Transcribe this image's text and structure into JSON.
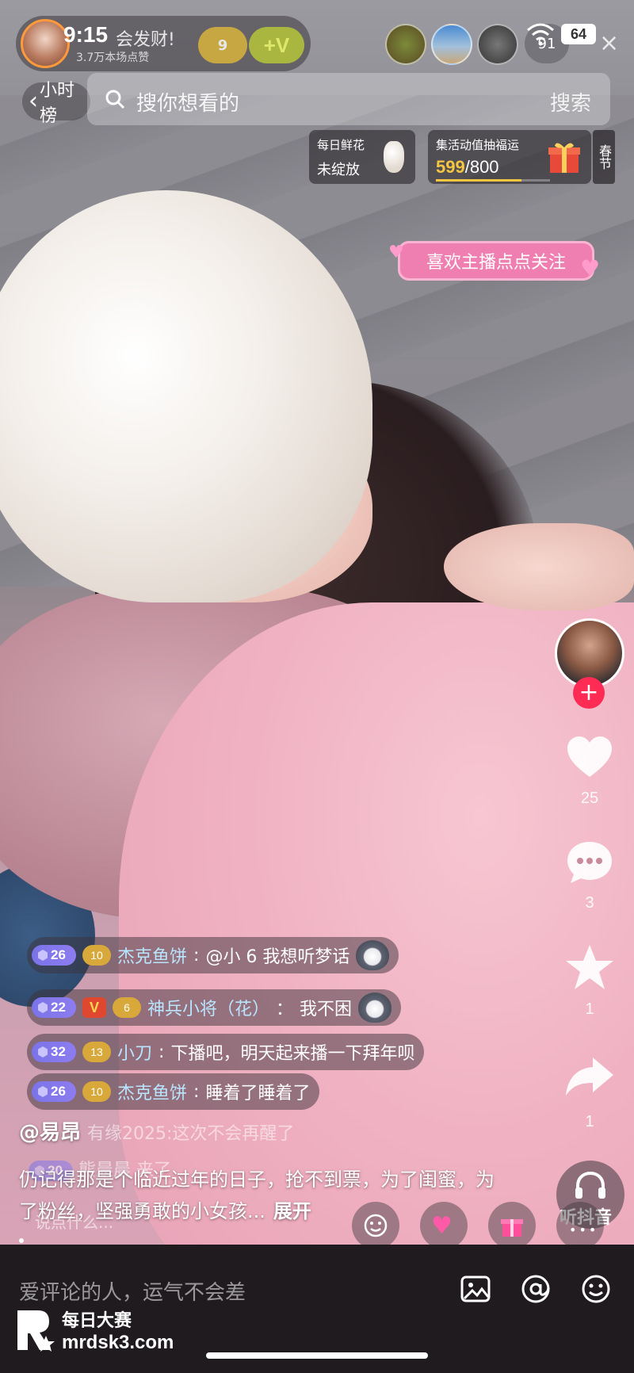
{
  "status_bar": {
    "time": "9:15",
    "battery": "64"
  },
  "anchor": {
    "name_suffix": "会发财!",
    "likes": "3.7万本场点赞",
    "badge_level": "9",
    "badge_v": "+V"
  },
  "viewers": {
    "count": "91"
  },
  "nav": {
    "back_label": "小时榜"
  },
  "search": {
    "placeholder": "搜你想看的",
    "button": "搜索"
  },
  "flower_card": {
    "title": "每日鲜花",
    "status": "未绽放"
  },
  "event_card": {
    "title": "集活动值抽福运",
    "current": "599",
    "total": "/800",
    "progress": 0.749,
    "tag": "春节"
  },
  "follow_prompt": "喜欢主播点点关注",
  "rail": {
    "like_count": "25",
    "comment_count": "3",
    "fav_count": "1",
    "share_count": "1",
    "listen_label": "听抖音"
  },
  "comments": [
    {
      "level": "26",
      "fan": "10",
      "user": "杰克鱼饼",
      "text": "@小 6 我想听梦话",
      "vip": false,
      "sticker": true
    },
    {
      "level": "22",
      "fan": "6",
      "user": "神兵小将（花）",
      "text": "我不困",
      "vip": true,
      "sticker": true
    },
    {
      "level": "32",
      "fan": "13",
      "user": "小刀",
      "text": "下播吧，明天起来播一下拜年呗",
      "vip": false,
      "sticker": false
    },
    {
      "level": "26",
      "fan": "10",
      "user": "杰克鱼饼",
      "text": "睡着了睡着了",
      "vip": false,
      "sticker": false
    }
  ],
  "faint_comments": [
    {
      "text": "有缘2025:这次不会再醒了"
    },
    {
      "level": "20",
      "text": "熊晨晨 来了"
    }
  ],
  "caption": {
    "author": "@易昂",
    "text": "仍记得那是个临近过年的日子，抢不到票，为了闺蜜，为了粉丝，坚强勇敢的小女孩...",
    "expand": "展开"
  },
  "live_input_placeholder": "说点什么...",
  "bottom_input_placeholder": "爱评论的人，运气不会差",
  "watermark": {
    "line1": "每日大赛",
    "line2": "mrdsk3.com"
  },
  "colors": {
    "accent_pink": "#fe2c55",
    "gold": "#f5c740",
    "level_purple": "#7a74e8",
    "username_blue": "#b8e6ff"
  }
}
